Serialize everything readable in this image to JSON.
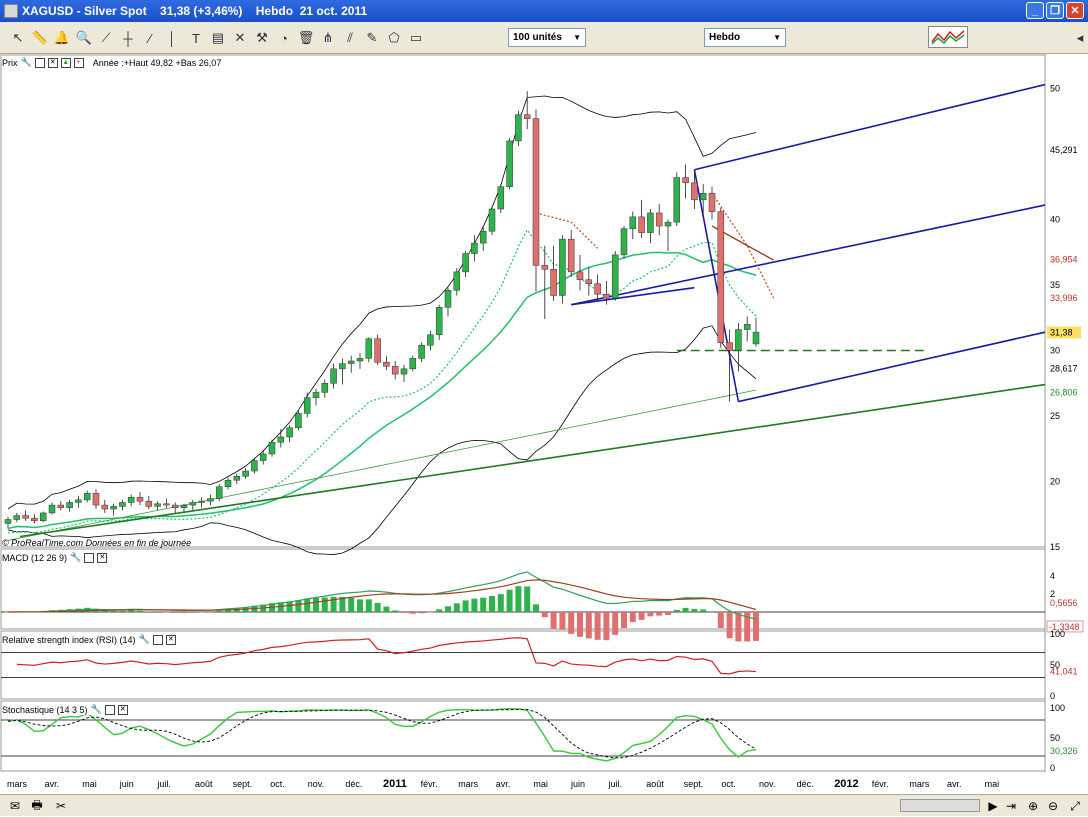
{
  "window": {
    "title": "XAGUSD - Silver Spot    31,38 (+3,46%)    Hebdo  21 oct. 2011"
  },
  "toolbar": {
    "units_value": "100 unités",
    "period_value": "Hebdo",
    "icons": [
      "cursor-icon",
      "ruler-icon",
      "alarm-icon",
      "zoom-icon",
      "horizontal-line-icon",
      "line-icon",
      "vertical-line-icon",
      "text-icon",
      "fibonacci-icon",
      "hammer-icon",
      "trash-icon",
      "pitchfork-icon",
      "channel-icon",
      "rectangle-icon"
    ]
  },
  "panes": {
    "price": {
      "title": "Prix",
      "legend": "Année :+Haut 49,82 +Bas 26,07",
      "source": "© ProRealTime.com  Données en fin de journée"
    },
    "macd": {
      "title": "MACD (12 26 9)"
    },
    "rsi": {
      "title": "Relative strength index (RSI) (14)"
    },
    "stoch": {
      "title": "Stochastique (14 3 5)"
    }
  },
  "colors": {
    "up": "#2db34a",
    "down": "#e07070",
    "pitchfork": "#1a1aa8",
    "trend": "#1f7a1f",
    "ema": "#20c070",
    "bollinger": "#000000",
    "macd_line": "#2ea060",
    "signal_line": "#a04020"
  },
  "chart_data": [
    {
      "type": "candlestick",
      "name": "price",
      "ylim": [
        15,
        52
      ],
      "yticks": [
        "50",
        "40",
        "35",
        "30",
        "25",
        "20",
        "15"
      ],
      "price_labels": {
        "last": "31,38",
        "pitch_top": "45,291",
        "red1": "36,954",
        "red2": "33,996",
        "dark": "28,617",
        "green": "26,806"
      },
      "xticks": [
        "mars",
        "avr.",
        "mai",
        "juin",
        "juil.",
        "août",
        "sept.",
        "oct.",
        "nov.",
        "déc.",
        "2011",
        "févr.",
        "mars",
        "avr.",
        "mai",
        "juin",
        "juil.",
        "août",
        "sept.",
        "oct.",
        "nov.",
        "déc.",
        "2012",
        "févr.",
        "mars",
        "avr.",
        "mai"
      ],
      "candles": [
        [
          16.8,
          17.3,
          16.4,
          17.1
        ],
        [
          17.1,
          17.6,
          16.9,
          17.4
        ],
        [
          17.4,
          17.8,
          17.0,
          17.2
        ],
        [
          17.2,
          17.5,
          16.8,
          17.0
        ],
        [
          17.0,
          17.7,
          16.9,
          17.6
        ],
        [
          17.6,
          18.4,
          17.5,
          18.2
        ],
        [
          18.2,
          18.5,
          17.8,
          18.0
        ],
        [
          18.0,
          18.6,
          17.7,
          18.4
        ],
        [
          18.4,
          18.9,
          18.0,
          18.6
        ],
        [
          18.6,
          19.3,
          18.4,
          19.1
        ],
        [
          19.1,
          19.4,
          17.9,
          18.2
        ],
        [
          18.2,
          18.6,
          17.6,
          17.9
        ],
        [
          17.9,
          18.3,
          17.4,
          18.1
        ],
        [
          18.1,
          18.6,
          17.8,
          18.4
        ],
        [
          18.4,
          19.0,
          18.1,
          18.8
        ],
        [
          18.8,
          19.2,
          18.2,
          18.5
        ],
        [
          18.5,
          18.9,
          17.9,
          18.1
        ],
        [
          18.1,
          18.5,
          17.8,
          18.3
        ],
        [
          18.3,
          18.7,
          18.0,
          18.2
        ],
        [
          18.2,
          18.4,
          17.6,
          18.0
        ],
        [
          18.0,
          18.3,
          17.7,
          18.2
        ],
        [
          18.2,
          18.6,
          17.8,
          18.4
        ],
        [
          18.4,
          18.8,
          18.0,
          18.5
        ],
        [
          18.5,
          19.0,
          18.2,
          18.7
        ],
        [
          18.7,
          19.8,
          18.5,
          19.6
        ],
        [
          19.6,
          20.3,
          19.4,
          20.1
        ],
        [
          20.1,
          20.6,
          19.8,
          20.4
        ],
        [
          20.4,
          21.0,
          20.2,
          20.8
        ],
        [
          20.8,
          21.8,
          20.6,
          21.6
        ],
        [
          21.6,
          22.4,
          21.3,
          22.1
        ],
        [
          22.1,
          23.2,
          21.9,
          23.0
        ],
        [
          23.0,
          24.0,
          22.6,
          23.4
        ],
        [
          23.4,
          24.3,
          23.0,
          24.1
        ],
        [
          24.1,
          25.4,
          23.9,
          25.2
        ],
        [
          25.2,
          26.8,
          24.9,
          26.4
        ],
        [
          26.4,
          27.1,
          25.8,
          26.8
        ],
        [
          26.8,
          27.8,
          26.4,
          27.5
        ],
        [
          27.5,
          29.0,
          27.1,
          28.6
        ],
        [
          28.6,
          29.4,
          27.4,
          29.0
        ],
        [
          29.0,
          29.6,
          28.3,
          29.2
        ],
        [
          29.2,
          29.8,
          28.6,
          29.4
        ],
        [
          29.4,
          31.0,
          29.1,
          30.9
        ],
        [
          30.9,
          31.2,
          28.9,
          29.1
        ],
        [
          29.1,
          29.6,
          28.5,
          28.8
        ],
        [
          28.8,
          29.2,
          27.8,
          28.2
        ],
        [
          28.2,
          28.9,
          27.6,
          28.6
        ],
        [
          28.6,
          29.6,
          28.4,
          29.4
        ],
        [
          29.4,
          30.6,
          29.1,
          30.4
        ],
        [
          30.4,
          31.5,
          30.0,
          31.2
        ],
        [
          31.2,
          33.5,
          30.8,
          33.3
        ],
        [
          33.3,
          34.8,
          32.6,
          34.6
        ],
        [
          34.6,
          36.3,
          34.2,
          36.0
        ],
        [
          36.0,
          37.6,
          35.6,
          37.4
        ],
        [
          37.4,
          38.8,
          36.8,
          38.2
        ],
        [
          38.2,
          39.5,
          37.6,
          39.1
        ],
        [
          39.1,
          41.0,
          38.8,
          40.8
        ],
        [
          40.8,
          42.7,
          40.5,
          42.5
        ],
        [
          42.5,
          46.2,
          42.3,
          46.0
        ],
        [
          46.0,
          48.3,
          45.6,
          48.0
        ],
        [
          48.0,
          49.8,
          46.9,
          47.7
        ],
        [
          47.7,
          48.4,
          34.5,
          36.5
        ],
        [
          36.5,
          38.0,
          32.4,
          36.2
        ],
        [
          36.2,
          38.0,
          33.8,
          34.2
        ],
        [
          34.2,
          38.8,
          33.6,
          38.5
        ],
        [
          38.5,
          39.2,
          35.6,
          36.0
        ],
        [
          36.0,
          37.3,
          34.6,
          35.4
        ],
        [
          35.4,
          36.4,
          34.2,
          35.1
        ],
        [
          35.1,
          35.8,
          33.8,
          34.3
        ],
        [
          34.3,
          35.3,
          33.5,
          34.0
        ],
        [
          34.0,
          37.6,
          33.8,
          37.3
        ],
        [
          37.3,
          39.5,
          37.0,
          39.3
        ],
        [
          39.3,
          40.6,
          38.5,
          40.2
        ],
        [
          40.2,
          41.5,
          38.6,
          39.0
        ],
        [
          39.0,
          40.8,
          38.2,
          40.5
        ],
        [
          40.5,
          41.2,
          38.8,
          39.5
        ],
        [
          39.5,
          40.0,
          37.6,
          39.8
        ],
        [
          39.8,
          43.6,
          39.5,
          43.2
        ],
        [
          43.2,
          44.2,
          41.6,
          42.8
        ],
        [
          42.8,
          43.5,
          40.8,
          41.5
        ],
        [
          41.5,
          42.7,
          40.2,
          42.0
        ],
        [
          42.0,
          42.5,
          40.0,
          40.6
        ],
        [
          40.6,
          40.9,
          30.2,
          30.6
        ],
        [
          30.6,
          31.6,
          26.1,
          30.0
        ],
        [
          30.0,
          32.1,
          28.4,
          31.6
        ],
        [
          31.6,
          32.6,
          30.7,
          32.0
        ],
        [
          30.5,
          32.5,
          30.3,
          31.4
        ]
      ]
    },
    {
      "type": "line",
      "name": "MACD (12 26 9)",
      "yticks": [
        "4",
        "2",
        "0,5656",
        "-1,3348"
      ],
      "series": [
        {
          "name": "MACD"
        },
        {
          "name": "Signal"
        },
        {
          "name": "Histogram"
        }
      ]
    },
    {
      "type": "line",
      "name": "Relative strength index (RSI) (14)",
      "yticks": [
        "100",
        "50",
        "0"
      ],
      "last_label": "41,041",
      "levels": [
        70,
        30
      ]
    },
    {
      "type": "line",
      "name": "Stochastique (14 3 5)",
      "yticks": [
        "100",
        "50",
        "0"
      ],
      "last_label": "30,326",
      "levels": [
        80,
        20
      ]
    }
  ]
}
